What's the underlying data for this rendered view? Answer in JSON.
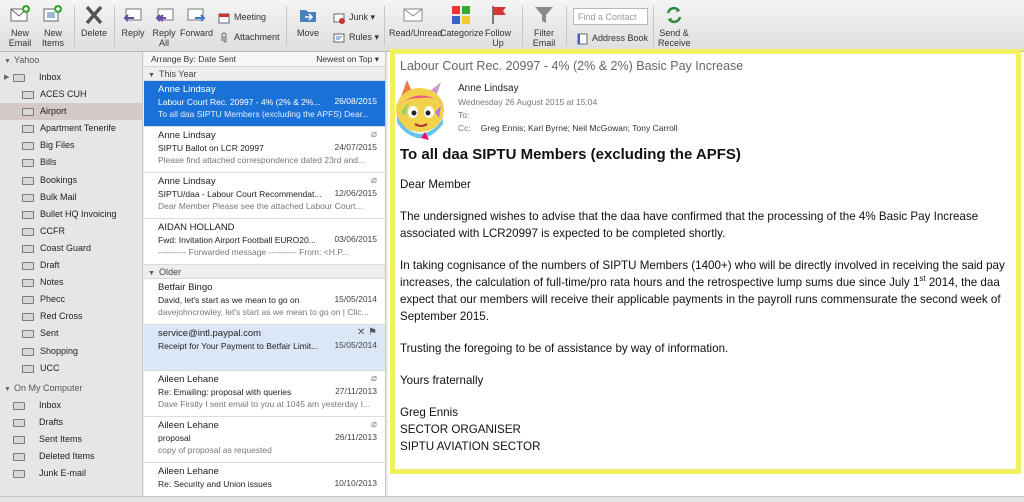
{
  "toolbar": {
    "new_email": "New Email",
    "new_items": "New Items",
    "delete": "Delete",
    "reply": "Reply",
    "reply_all": "Reply All",
    "forward": "Forward",
    "meeting": "Meeting",
    "attachment": "Attachment",
    "move": "Move",
    "junk": "Junk",
    "rules": "Rules",
    "read_unread": "Read/Unread",
    "categorize": "Categorize",
    "follow_up": "Follow Up",
    "filter_email": "Filter Email",
    "find_contact_placeholder": "Find a Contact",
    "address_book": "Address Book",
    "send_receive": "Send & Receive"
  },
  "sidebar": {
    "account1": "Yahoo",
    "account1_folders": [
      "Inbox",
      "ACES CUH",
      "Airport",
      "Apartment Tenerife",
      "Big Files",
      "Bills",
      "Bookings",
      "Bulk Mail",
      "Bullet HQ Invoicing",
      "CCFR",
      "Coast Guard",
      "Draft",
      "Notes",
      "Phecc",
      "Red Cross",
      "Sent",
      "Shopping",
      "UCC"
    ],
    "account2": "On My Computer",
    "account2_folders": [
      "Inbox",
      "Drafts",
      "Sent Items",
      "Deleted Items",
      "Junk E-mail"
    ]
  },
  "list": {
    "arrange_by": "Arrange By: Date Sent",
    "sort_order": "Newest on Top",
    "group1": "This Year",
    "group2": "Older",
    "messages_this_year": [
      {
        "from": "Anne Lindsay",
        "subject": "Labour Court Rec. 20997 - 4% (2% & 2%...",
        "date": "26/08/2015",
        "preview": "To all daa SIPTU Members (excluding the APFS) Dear..."
      },
      {
        "from": "Anne Lindsay",
        "subject": "SIPTU Ballot on LCR 20997",
        "date": "24/07/2015",
        "preview": "Please find attached correspondence dated 23rd and..."
      },
      {
        "from": "Anne Lindsay",
        "subject": "SIPTU/daa - Labour Court Recommendat...",
        "date": "12/06/2015",
        "preview": "Dear Member Please see the attached Labour Court..."
      },
      {
        "from": "AIDAN HOLLAND",
        "subject": "Fwd: Invitation Airport Football EURO20...",
        "date": "03/06/2015",
        "preview": "---------- Forwarded message ---------- From: <H.P..."
      }
    ],
    "messages_older": [
      {
        "from": "Betfair Bingo",
        "subject": "David, let's start as we mean to go on",
        "date": "15/05/2014",
        "preview": "davejohncrowley, let's start as we mean to go on | Clic..."
      },
      {
        "from": "service@intl.paypal.com",
        "subject": "Receipt for Your Payment to Betfair Limit...",
        "date": "15/05/2014",
        "preview": ""
      },
      {
        "from": "Aileen Lehane",
        "subject": "Re: Emailing: proposal with queries",
        "date": "27/11/2013",
        "preview": "Dave Firstly I sent email to you at 1045 am yesterday I..."
      },
      {
        "from": "Aileen Lehane",
        "subject": "proposal",
        "date": "26/11/2013",
        "preview": "copy of proposal as requested"
      },
      {
        "from": "Aileen Lehane",
        "subject": "Re: Security and Union issues",
        "date": "10/10/2013",
        "preview": ""
      }
    ]
  },
  "reader": {
    "subject": "Labour Court Rec. 20997 - 4% (2% & 2%) Basic Pay Increase",
    "from": "Anne Lindsay",
    "date": "Wednesday 26 August 2015 at 15:04",
    "to_label": "To:",
    "cc_label": "Cc:",
    "cc": "Greg Ennis;   Karl Byrne;   Neil McGowan;   Tony Carroll",
    "heading": "To all daa SIPTU Members (excluding the APFS)",
    "greeting": "Dear Member",
    "para1": "The undersigned wishes to advise that the daa have confirmed that the processing of the 4% Basic Pay Increase associated with LCR20997 is expected to be completed shortly.",
    "para2_a": "In taking cognisance of the numbers of SIPTU Members (1400+) who will be directly involved in receiving the said pay increases, the calculation of full-time/pro rata hours and the retrospective lump sums due since July 1",
    "para2_sup": "st",
    "para2_b": " 2014, the daa expect that our members will receive their applicable payments in the payroll runs commensurate the second week of September 2015.",
    "para3": "Trusting the foregoing to be of assistance by way of information.",
    "closing": "Yours fraternally",
    "sig_name": "Greg Ennis",
    "sig_title": "SECTOR ORGANISER",
    "sig_sector": "SIPTU AVIATION SECTOR"
  },
  "colors": {
    "selection": "#1a72d9",
    "highlight_border": "#f0f060",
    "selected_folder": "#d6c9c9"
  }
}
